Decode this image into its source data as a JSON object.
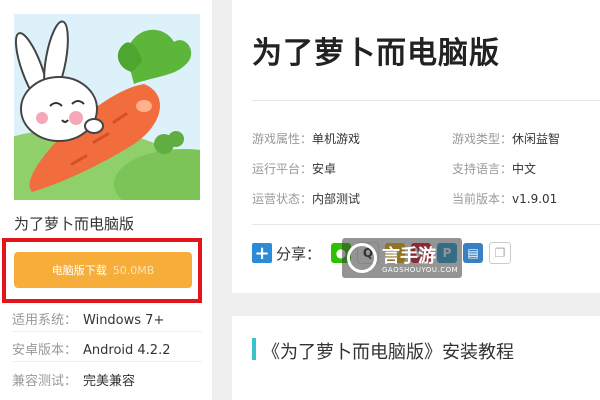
{
  "game": {
    "title": "为了萝卜而电脑版",
    "download_label": "电脑版下载",
    "download_size": "50.0MB"
  },
  "side_info": [
    {
      "key": "适用系统：",
      "value": "Windows 7+"
    },
    {
      "key": "安卓版本：",
      "value": "Android 4.2.2"
    },
    {
      "key": "兼容测试：",
      "value": "完美兼容"
    }
  ],
  "header": {
    "title": "为了萝卜而电脑版"
  },
  "attributes": [
    {
      "key": "游戏属性：",
      "value": "单机游戏"
    },
    {
      "key": "游戏类型：",
      "value": "休闲益智"
    },
    {
      "key": "运行平台：",
      "value": "安卓"
    },
    {
      "key": "支持语言：",
      "value": "中文"
    },
    {
      "key": "运营状态：",
      "value": "内部测试"
    },
    {
      "key": "当前版本：",
      "value": "v1.9.01"
    }
  ],
  "share": {
    "label": "分享：",
    "icons": [
      "wechat-icon",
      "qq-icon",
      "qzone-star-icon",
      "weibo-icon",
      "tencent-weibo-icon",
      "print-icon",
      "copy-icon"
    ]
  },
  "watermark": {
    "name": "言手游",
    "domain": "GAOSHOUYOU.COM"
  },
  "tutorial": {
    "title": "《为了萝卜而电脑版》安装教程"
  },
  "colors": {
    "download": "#f6ad39",
    "highlight_frame": "#e3151a",
    "share_plus": "#2c8bd8",
    "tutorial_accent": "#3cc2c7"
  }
}
